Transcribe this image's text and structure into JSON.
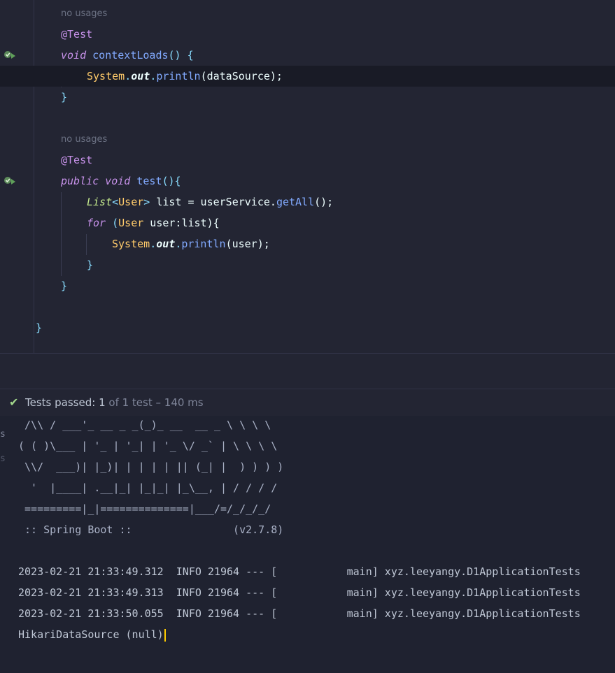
{
  "editor": {
    "hint_no_usages": "no usages",
    "lines": {
      "l1_ann": "@Test",
      "l2_void": "void",
      "l2_name": "contextLoads",
      "l2_rest": "() {",
      "l3_system": "System",
      "l3_out": "out",
      "l3_println": "println",
      "l3_arg": "(dataSource);",
      "l4": "}",
      "l5_ann": "@Test",
      "l6_public": "public",
      "l6_void": "void",
      "l6_name": "test",
      "l6_rest": "(){",
      "l7_list": "List",
      "l7_lt": "<",
      "l7_user": "User",
      "l7_gt": ">",
      "l7_mid": " list = userService.",
      "l7_getall": "getAll",
      "l7_end": "();",
      "l8_for": "for",
      "l8_paren": " (",
      "l8_user": "User",
      "l8_rest": " user:list){",
      "l9_system": "System",
      "l9_out": "out",
      "l9_println": "println",
      "l9_arg": "(user);",
      "l10": "}",
      "l11": "}",
      "l12": "}"
    },
    "icons": [
      "run-test-passed-icon",
      "run-test-passed-icon"
    ]
  },
  "test_bar": {
    "check_icon": "check-icon",
    "label": "Tests passed:",
    "count": "1",
    "detail": "of 1 test – 140 ms"
  },
  "console": {
    "edge_glyphs": [
      "s",
      "s"
    ],
    "banner": [
      " /\\\\ / ___'_ __ _ _(_)_ __  __ _ \\ \\ \\ \\",
      "( ( )\\___ | '_ | '_| | '_ \\/ _` | \\ \\ \\ \\",
      " \\\\/  ___)| |_)| | | | | || (_| |  ) ) ) )",
      "  '  |____| .__|_| |_|_| |_\\__, | / / / /",
      " =========|_|==============|___/=/_/_/_/",
      " :: Spring Boot ::                (v2.7.8)"
    ],
    "logs": [
      "2023-02-21 21:33:49.312  INFO 21964 --- [           main] xyz.leeyangy.D1ApplicationTests",
      "2023-02-21 21:33:49.313  INFO 21964 --- [           main] xyz.leeyangy.D1ApplicationTests",
      "2023-02-21 21:33:50.055  INFO 21964 --- [           main] xyz.leeyangy.D1ApplicationTests"
    ],
    "output": "HikariDataSource (null)"
  },
  "colors": {
    "background": "#1f2230",
    "editor_bg": "#232533",
    "keyword": "#c792ea",
    "function": "#82aaff",
    "class": "#ffcb6b",
    "success": "#a3d88c"
  }
}
